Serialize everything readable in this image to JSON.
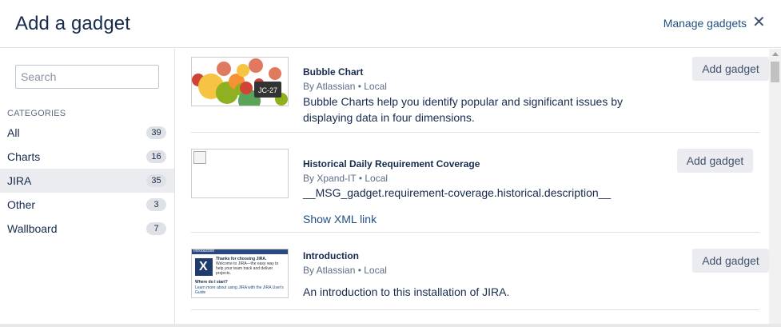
{
  "dialog": {
    "title": "Add a gadget",
    "manage_label": "Manage gadgets",
    "close_glyph": "✕"
  },
  "sidebar": {
    "search_placeholder": "Search",
    "categories_heading": "CATEGORIES",
    "categories": [
      {
        "label": "All",
        "count": "39",
        "active": false
      },
      {
        "label": "Charts",
        "count": "16",
        "active": false
      },
      {
        "label": "JIRA",
        "count": "35",
        "active": true
      },
      {
        "label": "Other",
        "count": "3",
        "active": false
      },
      {
        "label": "Wallboard",
        "count": "7",
        "active": false
      }
    ]
  },
  "gadgets": [
    {
      "name": "Bubble Chart",
      "author": "By Atlassian • Local",
      "description": "Bubble Charts help you identify popular and significant issues by displaying data in four dimensions.",
      "add_label": "Add gadget",
      "thumb_tooltip": "JC-27"
    },
    {
      "name": "Historical Daily Requirement Coverage",
      "author": "By Xpand-IT • Local",
      "description": "__MSG_gadget.requirement-coverage.historical.description__",
      "xml_link": "Show XML link",
      "add_label": "Add gadget"
    },
    {
      "name": "Introduction",
      "author": "By Atlassian • Local",
      "description": "An introduction to this installation of JIRA.",
      "add_label": "Add gadget",
      "thumb": {
        "header": "Introduction",
        "heading": "Thanks for choosing JIRA.",
        "body": "Welcome to JIRA—the easy way to help your team track and deliver projects.",
        "where": "Where do I start?",
        "learn": "Learn more about using JIRA with the JIRA User's Guide"
      }
    }
  ],
  "colors": {
    "link": "#205081",
    "button_bg": "#ebecf0",
    "active_bg": "#ebecf0",
    "border": "#dfe1e6"
  }
}
